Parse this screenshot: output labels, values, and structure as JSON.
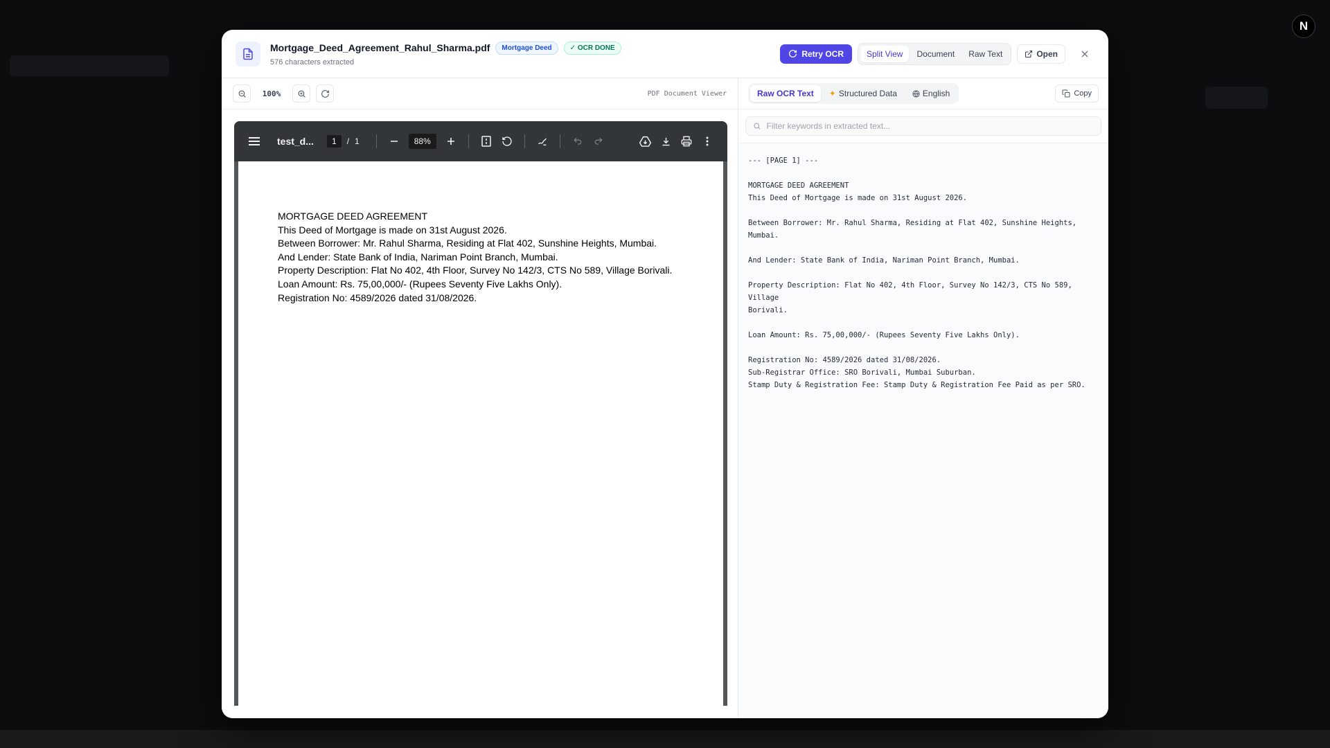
{
  "modal": {
    "file_name": "Mortgage_Deed_Agreement_Rahul_Sharma.pdf",
    "doc_type_badge": "Mortgage Deed",
    "ocr_badge": "OCR DONE",
    "chars_extracted": "576 characters extracted",
    "retry_label": "Retry OCR",
    "view_modes": [
      "Split View",
      "Document",
      "Raw Text"
    ],
    "open_label": "Open",
    "corner_initial": "N"
  },
  "viewer": {
    "zoom_label": "100%",
    "caption": "PDF Document Viewer"
  },
  "pdf": {
    "name": "test_d...",
    "page_current": "1",
    "page_total": "1",
    "zoom": "88%",
    "lines": [
      "MORTGAGE DEED AGREEMENT",
      "This Deed of Mortgage is made on 31st August 2026.",
      "Between Borrower: Mr. Rahul Sharma, Residing at Flat 402, Sunshine Heights, Mumbai.",
      "And Lender: State Bank of India, Nariman Point Branch, Mumbai.",
      "Property Description: Flat No 402, 4th Floor, Survey No 142/3, CTS No 589, Village Borivali.",
      "Loan Amount: Rs. 75,00,000/- (Rupees Seventy Five Lakhs Only).",
      "Registration No: 4589/2026 dated 31/08/2026."
    ]
  },
  "extract": {
    "tabs": [
      "Raw OCR Text",
      "Structured Data",
      "English"
    ],
    "copy_label": "Copy",
    "filter_placeholder": "Filter keywords in extracted text...",
    "raw_text": "--- [PAGE 1] ---\n\nMORTGAGE DEED AGREEMENT\nThis Deed of Mortgage is made on 31st August 2026.\n\nBetween Borrower: Mr. Rahul Sharma, Residing at Flat 402, Sunshine Heights,\nMumbai.\n\nAnd Lender: State Bank of India, Nariman Point Branch, Mumbai.\n\nProperty Description: Flat No 402, 4th Floor, Survey No 142/3, CTS No 589, Village\nBorivali.\n\nLoan Amount: Rs. 75,00,000/- (Rupees Seventy Five Lakhs Only).\n\nRegistration No: 4589/2026 dated 31/08/2026.\nSub-Registrar Office: SRO Borivali, Mumbai Suburban.\nStamp Duty & Registration Fee: Stamp Duty & Registration Fee Paid as per SRO."
  },
  "colors": {
    "accent": "#4f46e5",
    "success": "#047857",
    "pdf_toolbar": "#323639"
  }
}
